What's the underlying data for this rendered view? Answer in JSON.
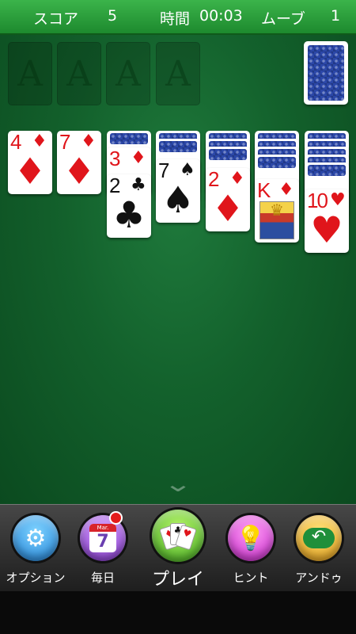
{
  "status": {
    "score_label": "スコア",
    "score_value": "5",
    "time_label": "時間",
    "time_value": "00:03",
    "moves_label": "ムーブ",
    "moves_value": "1"
  },
  "foundations": [
    "A",
    "A",
    "A",
    "A"
  ],
  "tableau": [
    {
      "rank": "4",
      "suit": "♦",
      "color": "red"
    },
    {
      "rank": "7",
      "suit": "♦",
      "color": "red"
    },
    {
      "rank": "3",
      "suit": "♦",
      "color": "red"
    },
    {
      "rank": "2",
      "suit": "♣",
      "color": "black"
    },
    {
      "rank": "7",
      "suit": "♠",
      "color": "black"
    },
    {
      "rank": "2",
      "suit": "♦",
      "color": "red"
    },
    {
      "rank": "K",
      "suit": "♦",
      "color": "red"
    },
    {
      "rank": "10",
      "suit": "♥",
      "color": "red"
    }
  ],
  "toolbar": {
    "options_label": "オプション",
    "daily_label": "毎日",
    "daily_month": "Mar.",
    "daily_day": "7",
    "play_label": "プレイ",
    "hint_label": "ヒント",
    "undo_label": "アンドゥ"
  },
  "icons": {
    "options": "gear-icon",
    "daily": "calendar-icon",
    "play": "cards-icon",
    "hint": "lightbulb-icon",
    "undo": "undo-arrow-icon",
    "expand": "chevron-down-icon"
  },
  "colors": {
    "header_green": "#2fa640",
    "felt_green": "#13612c",
    "card_red": "#e0151b",
    "card_back_blue": "#2b47a8",
    "notification_red": "#e31b1b"
  }
}
